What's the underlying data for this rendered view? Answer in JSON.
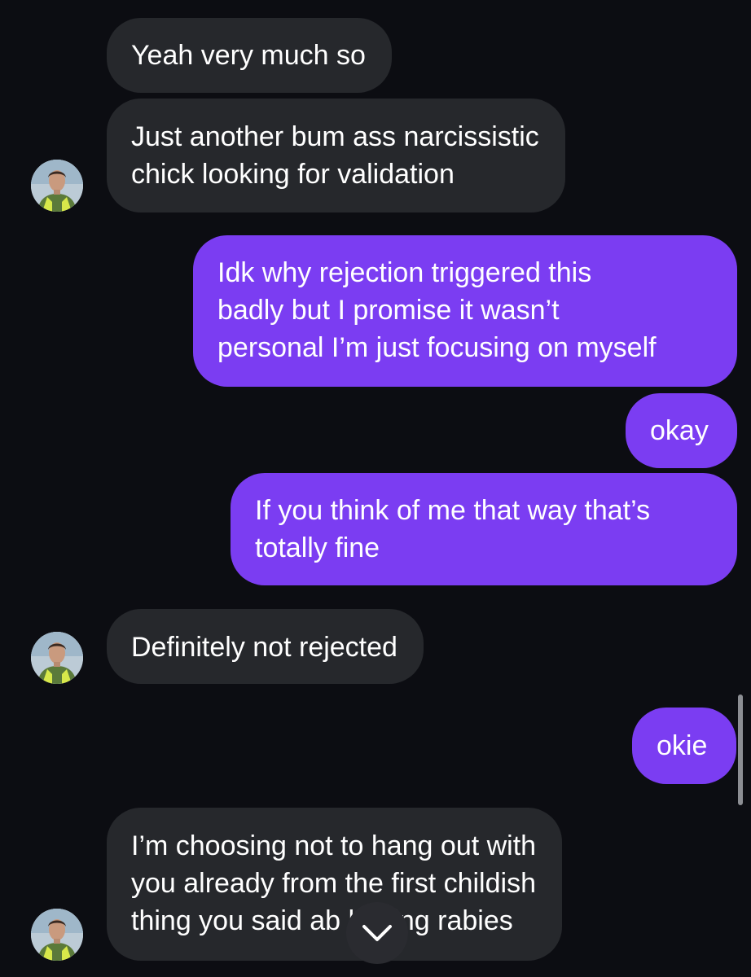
{
  "messages": [
    {
      "sender": "them",
      "text": "Yeah very much so"
    },
    {
      "sender": "them",
      "text": "Just another bum ass narcissistic\nchick looking for validation"
    },
    {
      "sender": "me",
      "text": "Idk why rejection triggered this\nbadly but I promise it wasn’t\npersonal I’m just focusing on myself"
    },
    {
      "sender": "me",
      "text": "okay"
    },
    {
      "sender": "me",
      "text": "If you think of me that way that’s\ntotally fine"
    },
    {
      "sender": "them",
      "text": "Definitely not rejected"
    },
    {
      "sender": "me",
      "text": "okie"
    },
    {
      "sender": "them",
      "text": "I’m choosing not to hang out with\nyou already from the first childish\nthing you said ab      having rabies"
    }
  ],
  "colors": {
    "background": "#0c0d12",
    "incoming_bubble": "#26282c",
    "outgoing_bubble": "#7b3df2",
    "text": "#ffffff"
  },
  "icons": {
    "avatar": "profile-photo",
    "scroll_down": "chevron-down-icon"
  }
}
